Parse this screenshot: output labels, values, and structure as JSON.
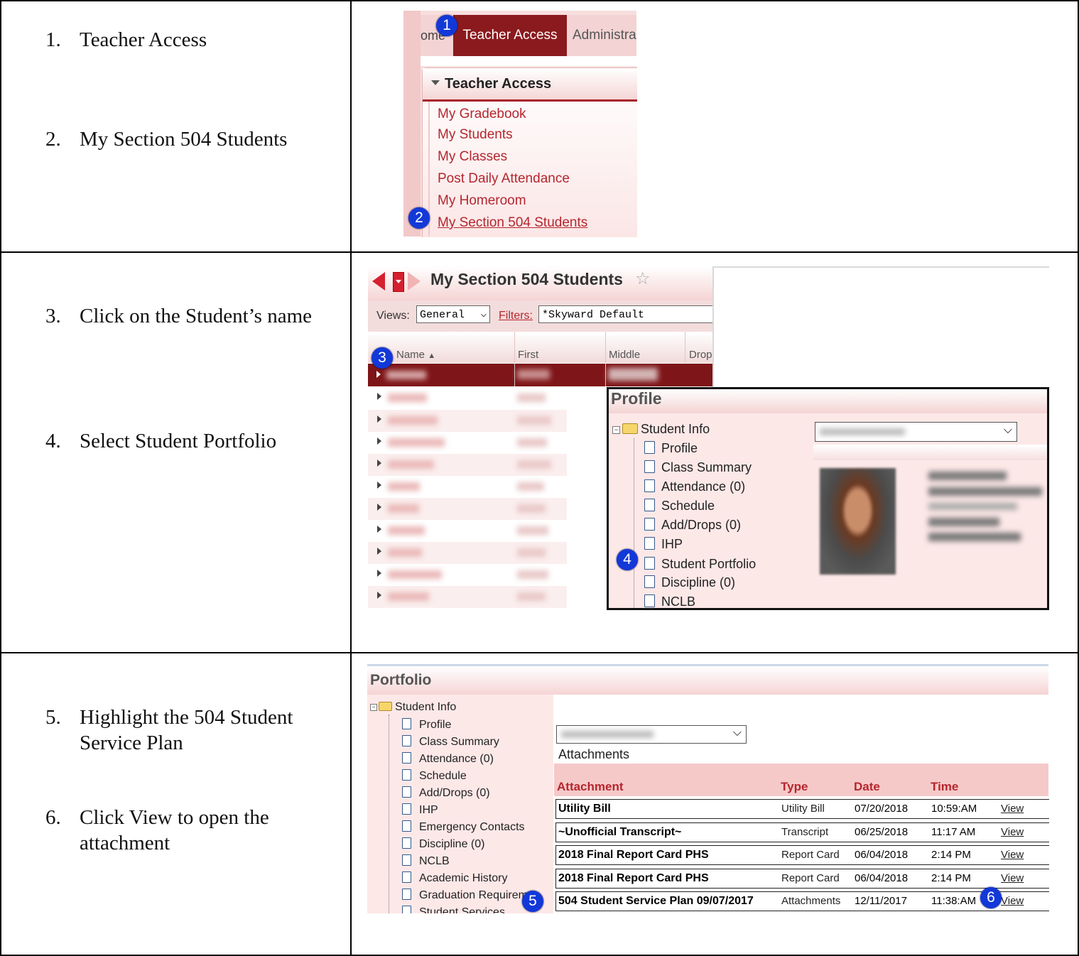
{
  "steps": [
    {
      "num": "1.",
      "text": "Teacher Access"
    },
    {
      "num": "2.",
      "text": "My Section 504 Students"
    },
    {
      "num": "3.",
      "text": "Click on the Student’s name"
    },
    {
      "num": "4.",
      "text": "Select Student Portfolio"
    },
    {
      "num": "5.",
      "text": "Highlight the 504 Student Service Plan"
    },
    {
      "num": "6.",
      "text": "Click View to open the attachment"
    }
  ],
  "badges": [
    "1",
    "2",
    "3",
    "4",
    "5",
    "6"
  ],
  "shot1": {
    "tabs": [
      "ome",
      "Teacher Access",
      "Administra"
    ],
    "section_title": "Teacher Access",
    "links": [
      "My Gradebook",
      "My Students",
      "My Classes",
      "Post Daily Attendance",
      "My Homeroom",
      "My Section 504 Students"
    ]
  },
  "shot2": {
    "title": "My Section 504 Students",
    "views_label": "Views:",
    "views_value": "General",
    "filters_label": "Filters:",
    "filters_value": "*Skyward Default",
    "columns": [
      "Name",
      "First",
      "Middle",
      "Drop"
    ],
    "profile_title": "Profile",
    "tree_root": "Student Info",
    "tree_items": [
      "Profile",
      "Class Summary",
      "Attendance (0)",
      "Schedule",
      "Add/Drops (0)",
      "IHP",
      "Student Portfolio",
      "Discipline (0)",
      "NCLB"
    ]
  },
  "shot3": {
    "title": "Portfolio",
    "tree_root": "Student Info",
    "tree_items": [
      "Profile",
      "Class Summary",
      "Attendance (0)",
      "Schedule",
      "Add/Drops (0)",
      "IHP",
      "Emergency Contacts",
      "Discipline (0)",
      "NCLB",
      "Academic History",
      "Graduation Requirem",
      "Student Services"
    ],
    "attachments_label": "Attachments",
    "headers": [
      "Attachment",
      "Type",
      "Date",
      "Time"
    ],
    "rows": [
      {
        "name": "Utility Bill",
        "type": "Utility Bill",
        "date": "07/20/2018",
        "time": "10:59:AM",
        "view": "View"
      },
      {
        "name": "~Unofficial Transcript~",
        "type": "Transcript",
        "date": "06/25/2018",
        "time": "11:17 AM",
        "view": "View"
      },
      {
        "name": "2018 Final Report Card PHS",
        "type": "Report Card",
        "date": "06/04/2018",
        "time": "2:14 PM",
        "view": "View"
      },
      {
        "name": "2018 Final Report Card PHS",
        "type": "Report Card",
        "date": "06/04/2018",
        "time": "2:14 PM",
        "view": "View"
      },
      {
        "name": "504 Student Service Plan 09/07/2017",
        "type": "Attachments",
        "date": "12/11/2017",
        "time": "11:38:AM",
        "view": "View"
      }
    ]
  }
}
